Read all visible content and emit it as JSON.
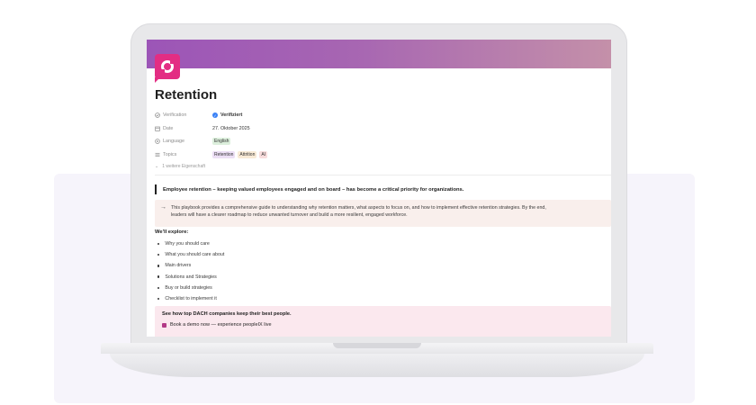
{
  "page": {
    "title": "Retention",
    "properties": [
      {
        "key": "Verification",
        "icon": "verification-icon",
        "value": "Verifiziert",
        "type": "verified"
      },
      {
        "key": "Date",
        "icon": "calendar-icon",
        "value": "27. Oktober 2025",
        "type": "text"
      },
      {
        "key": "Language",
        "icon": "language-icon",
        "value": "English",
        "type": "tag"
      },
      {
        "key": "Topics",
        "icon": "list-icon",
        "type": "tags",
        "tags": [
          "Retention",
          "Attrition",
          "AI"
        ]
      }
    ],
    "more_properties": "1 weitere Eigenschaft",
    "quote": "Employee retention – keeping valued employees engaged and on board – has become a critical priority for organizations.",
    "callout": {
      "line1": "This playbook provides a comprehensive guide to understanding why retention matters, what aspects to focus on, and how to implement effective retention strategies. By the end,",
      "line2": "leaders will have a clearer roadmap to reduce unwanted turnover and build a more resilient, engaged workforce."
    },
    "explore_heading": "We'll explore:",
    "explore_items": [
      "Why you should care",
      "What you should care about",
      "Main drivers",
      "Solutions and Strategies",
      "Buy or build strategies",
      "Checklist to implement it"
    ],
    "cta": {
      "heading": "See how top DACH companies keep their best people.",
      "link": "Book a demo now — experience peopleIX live"
    }
  },
  "colors": {
    "brand": "#e32d83",
    "cover_start": "#9c55b7",
    "cover_end": "#c490a9",
    "callout_bg": "#f9efec",
    "cta_bg": "#fbe8ee",
    "tag_language": "#dcefdc",
    "tag_retention": "#ecdff5",
    "tag_attrition": "#f8ead6",
    "tag_ai": "#f8dcdc"
  }
}
